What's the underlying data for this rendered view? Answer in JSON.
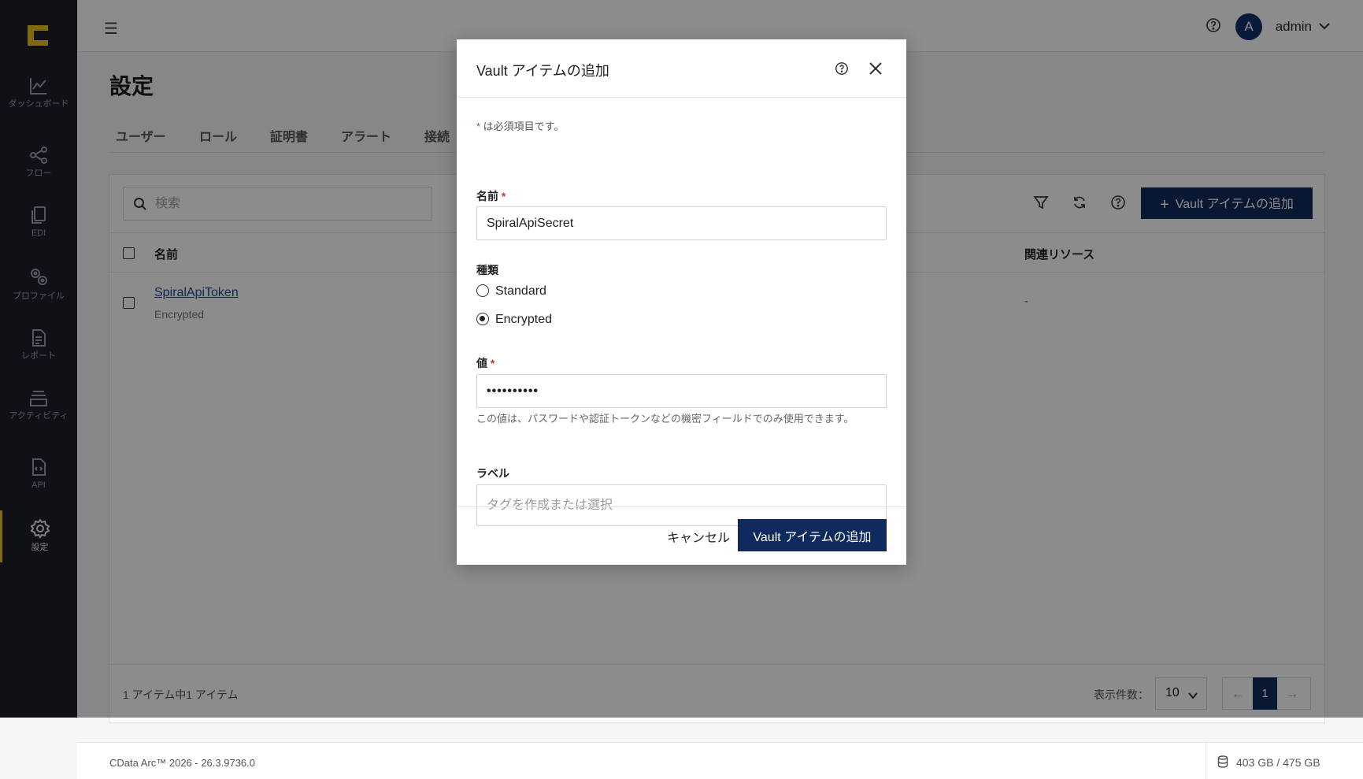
{
  "sidebar": {
    "items": [
      {
        "label": "ダッシュボード",
        "icon": "chart-icon"
      },
      {
        "label": "フロー",
        "icon": "share-icon"
      },
      {
        "label": "EDI",
        "icon": "documents-icon"
      },
      {
        "label": "プロファイル",
        "icon": "gears-icon"
      },
      {
        "label": "レポート",
        "icon": "report-icon"
      },
      {
        "label": "アクティビティ",
        "icon": "stack-icon"
      },
      {
        "label": "API",
        "icon": "api-file-icon"
      },
      {
        "label": "設定",
        "icon": "gear-icon"
      }
    ],
    "active_index": 7,
    "accent_color": "#e8c21a"
  },
  "header": {
    "avatar_initial": "A",
    "username": "admin"
  },
  "page": {
    "title": "設定",
    "tabs": [
      "ユーザー",
      "ロール",
      "証明書",
      "アラート",
      "接続"
    ]
  },
  "toolbar": {
    "search_placeholder": "検索",
    "add_button_label": "Vault アイテムの追加"
  },
  "table": {
    "columns": {
      "name": "名前",
      "related": "関連リソース"
    },
    "rows": [
      {
        "name": "SpiralApiToken",
        "type": "Encrypted",
        "related": "-"
      }
    ]
  },
  "pagination": {
    "count_text": "1 アイテム中1 アイテム",
    "per_page_label": "表示件数：",
    "per_page_value": "10",
    "current_page": "1",
    "prev_symbol": "←",
    "next_symbol": "→"
  },
  "footer": {
    "version": "CData Arc™ 2026 - 26.3.9736.0",
    "storage": "403 GB / 475 GB"
  },
  "modal": {
    "title": "Vault アイテムの追加",
    "required_note_star": "*",
    "required_note": " は必須項目です。",
    "name_label": "名前",
    "name_value": "SpiralApiSecret",
    "type_label": "種類",
    "type_options": [
      "Standard",
      "Encrypted"
    ],
    "type_selected": "Encrypted",
    "value_label": "値",
    "value_masked": "••••••••••",
    "value_hint": "この値は、パスワードや認証トークンなどの機密フィールドでのみ使用できます。",
    "label_label": "ラベル",
    "label_placeholder": "タグを作成または選択",
    "cancel_label": "キャンセル",
    "confirm_label": "Vault アイテムの追加",
    "required_star": "*"
  },
  "colors": {
    "primary": "#0f2a5c",
    "sidebar_bg": "#1c1f2b",
    "required": "#c0392b"
  }
}
